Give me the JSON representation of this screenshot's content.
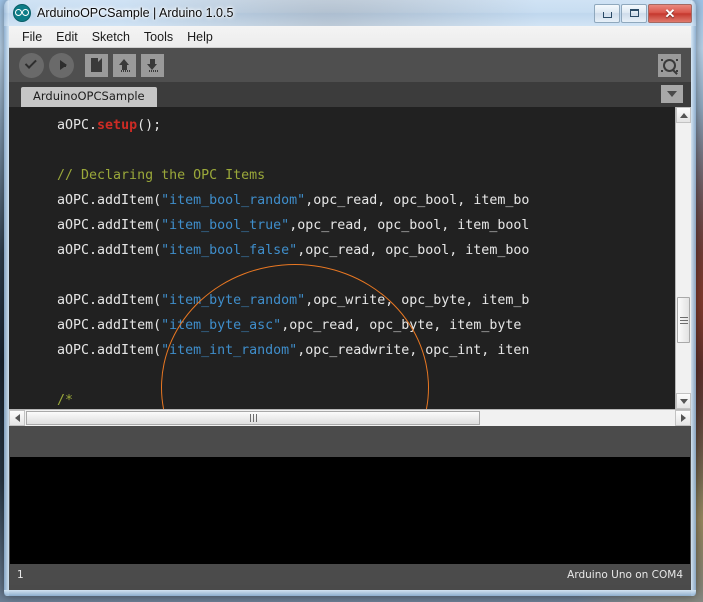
{
  "window": {
    "title": "ArduinoOPCSample | Arduino 1.0.5",
    "app_icon": "arduino-infinity-icon",
    "controls": {
      "minimize": "minimize-icon",
      "maximize": "maximize-icon",
      "close": "✕"
    }
  },
  "menu": {
    "items": [
      {
        "label": "File"
      },
      {
        "label": "Edit"
      },
      {
        "label": "Sketch"
      },
      {
        "label": "Tools"
      },
      {
        "label": "Help"
      }
    ]
  },
  "toolbar": {
    "verify_label": "Verify",
    "upload_label": "Upload",
    "new_label": "New",
    "open_label": "Open",
    "save_label": "Save",
    "serial_monitor_label": "Serial Monitor"
  },
  "tabs": {
    "active": "ArduinoOPCSample",
    "dropdown_icon": "chevron-down-icon"
  },
  "editor": {
    "lines": [
      {
        "segments": [
          {
            "t": "  aOPC.",
            "c": "plain"
          },
          {
            "t": "setup",
            "c": "kw"
          },
          {
            "t": "();",
            "c": "plain"
          }
        ]
      },
      {
        "segments": [
          {
            "t": "",
            "c": "plain"
          }
        ]
      },
      {
        "segments": [
          {
            "t": "  // Declaring the OPC Items",
            "c": "cmt"
          }
        ]
      },
      {
        "segments": [
          {
            "t": "  aOPC.addItem(",
            "c": "plain"
          },
          {
            "t": "\"item_bool_random\"",
            "c": "str"
          },
          {
            "t": ",opc_read, opc_bool, item_bo",
            "c": "plain"
          }
        ]
      },
      {
        "segments": [
          {
            "t": "  aOPC.addItem(",
            "c": "plain"
          },
          {
            "t": "\"item_bool_true\"",
            "c": "str"
          },
          {
            "t": ",opc_read, opc_bool, item_bool",
            "c": "plain"
          }
        ]
      },
      {
        "segments": [
          {
            "t": "  aOPC.addItem(",
            "c": "plain"
          },
          {
            "t": "\"item_bool_false\"",
            "c": "str"
          },
          {
            "t": ",opc_read, opc_bool, item_boo",
            "c": "plain"
          }
        ]
      },
      {
        "segments": [
          {
            "t": "",
            "c": "plain"
          }
        ]
      },
      {
        "segments": [
          {
            "t": "  aOPC.addItem(",
            "c": "plain"
          },
          {
            "t": "\"item_byte_random\"",
            "c": "str"
          },
          {
            "t": ",opc_write, opc_byte, item_b",
            "c": "plain"
          }
        ]
      },
      {
        "segments": [
          {
            "t": "  aOPC.addItem(",
            "c": "plain"
          },
          {
            "t": "\"item_byte_asc\"",
            "c": "str"
          },
          {
            "t": ",opc_read, opc_byte, item_byte",
            "c": "plain"
          }
        ]
      },
      {
        "segments": [
          {
            "t": "  aOPC.addItem(",
            "c": "plain"
          },
          {
            "t": "\"item_int_random\"",
            "c": "str"
          },
          {
            "t": ",opc_readwrite, opc_int, iten",
            "c": "plain"
          }
        ]
      },
      {
        "segments": [
          {
            "t": "",
            "c": "plain"
          }
        ]
      },
      {
        "segments": [
          {
            "t": "  /*",
            "c": "cmt"
          }
        ]
      }
    ],
    "colors": {
      "background": "#212121",
      "text": "#e6e6e6",
      "keyword": "#cc2b24",
      "string": "#3f8ecb",
      "comment": "#9aa83a",
      "annotation": "#e87722"
    },
    "annotation_shape": "orange-ellipse-highlight"
  },
  "scrollbars": {
    "vertical_up_icon": "triangle-up-icon",
    "vertical_down_icon": "triangle-down-icon",
    "horizontal_left_icon": "triangle-left-icon",
    "horizontal_right_icon": "triangle-right-icon"
  },
  "console": {
    "message": "",
    "text": ""
  },
  "status": {
    "line_number": "1",
    "board": "Arduino Uno on COM4"
  }
}
